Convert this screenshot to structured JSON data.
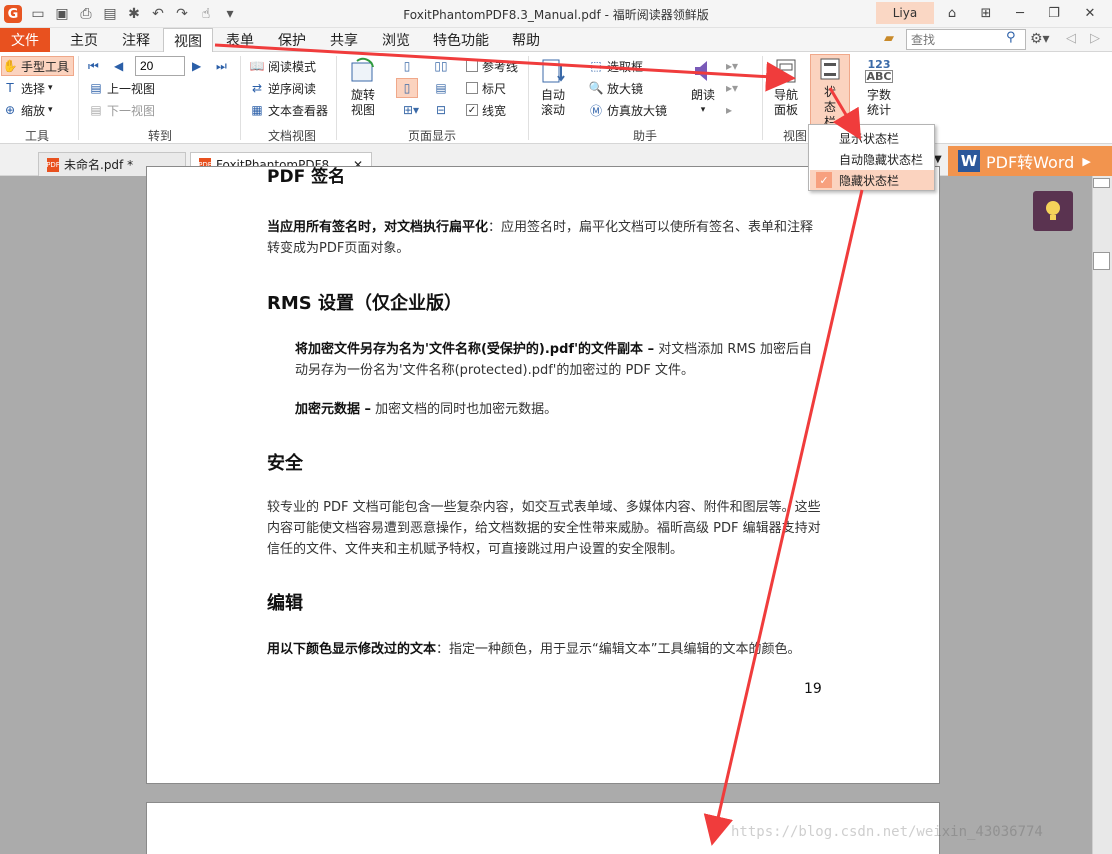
{
  "window": {
    "title": "FoxitPhantomPDF8.3_Manual.pdf - 福昕阅读器领鲜版",
    "user": "Liya"
  },
  "menu": {
    "file": "文件",
    "tabs": [
      "主页",
      "注释",
      "视图",
      "表单",
      "保护",
      "共享",
      "浏览",
      "特色功能",
      "帮助"
    ],
    "active_tab": "视图",
    "search_placeholder": "查找"
  },
  "ribbon": {
    "tools": {
      "label": "工具",
      "hand": "手型工具",
      "select": "选择",
      "zoom": "缩放"
    },
    "goto": {
      "label": "转到",
      "page": "20",
      "prev_view": "上一视图",
      "next_view": "下一视图"
    },
    "doc_view": {
      "label": "文档视图",
      "read_mode": "阅读模式",
      "reverse": "逆序阅读",
      "text_viewer": "文本查看器"
    },
    "page_display": {
      "label": "页面显示",
      "rotate": "旋转视图",
      "guides": "参考线",
      "rulers": "标尺",
      "line_weights": "线宽",
      "line_weights_checked": true
    },
    "assistant": {
      "label": "助手",
      "auto_scroll": "自动滚动",
      "select_box": "选取框",
      "magnifier": "放大镜",
      "loupe": "仿真放大镜",
      "read_aloud": "朗读"
    },
    "views": {
      "label": "视图",
      "nav_panel": "导航面板",
      "status_bar": "状态栏",
      "word_count": "字数统计",
      "word_count_icon_text": "123",
      "word_count_icon_sub": "ABC"
    }
  },
  "doc_tabs": [
    {
      "title": "未命名.pdf *"
    },
    {
      "title": "FoxitPhantomPDF8...."
    }
  ],
  "pdf_to_word": "PDF转Word",
  "status_menu": {
    "items": [
      "显示状态栏",
      "自动隐藏状态栏",
      "隐藏状态栏"
    ],
    "checked_index": 2
  },
  "document": {
    "top_heading": "PDF 签名",
    "p1_bold": "当应用所有签名时，对文档执行扁平化",
    "p1_text": "：应用签名时，扁平化文档可以使所有签名、表单和注释转变成为PDF页面对象。",
    "h_rms": "RMS 设置（仅企业版）",
    "p2_bold": "将加密文件另存为名为'文件名称(受保护的).pdf'的文件副本 –",
    "p2_text": " 对文档添加 RMS 加密后自动另存为一份名为'文件名称(protected).pdf'的加密过的 PDF 文件。",
    "p3_bold": "加密元数据 –",
    "p3_text": " 加密文档的同时也加密元数据。",
    "h_security": "安全",
    "p4_text": "较专业的 PDF 文档可能包含一些复杂内容，如交互式表单域、多媒体内容、附件和图层等。这些内容可能使文档容易遭到恶意操作，给文档数据的安全性带来威胁。福昕高级 PDF 编辑器支持对信任的文件、文件夹和主机赋予特权，可直接跳过用户设置的安全限制。",
    "h_edit": "编辑",
    "p5_bold": "用以下颜色显示修改过的文本",
    "p5_text": "：指定一种颜色，用于显示“编辑文本”工具编辑的文本的颜色。",
    "page_number": "19"
  },
  "watermark": "https://blog.csdn.net/weixin_43036774",
  "colors": {
    "accent": "#e8511f",
    "highlight": "#fbd3bf",
    "annotation_arrow": "#f03c3c"
  }
}
